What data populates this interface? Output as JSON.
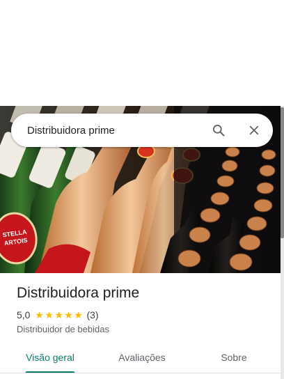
{
  "search": {
    "value": "Distribuidora prime"
  },
  "icons": {
    "search": "search-icon",
    "close": "close-icon"
  },
  "place": {
    "name": "Distribuidora prime",
    "rating": "5,0",
    "stars": 5,
    "reviews_count": "(3)",
    "category": "Distribuidor de bebidas"
  },
  "tabs": [
    {
      "label": "Visão geral",
      "active": true
    },
    {
      "label": "Avaliações",
      "active": false
    },
    {
      "label": "Sobre",
      "active": false
    }
  ],
  "hero_image": {
    "logo_text": "STELLA ARTOIS"
  },
  "colors": {
    "accent": "#0b7c6c",
    "star": "#fbbc04"
  }
}
